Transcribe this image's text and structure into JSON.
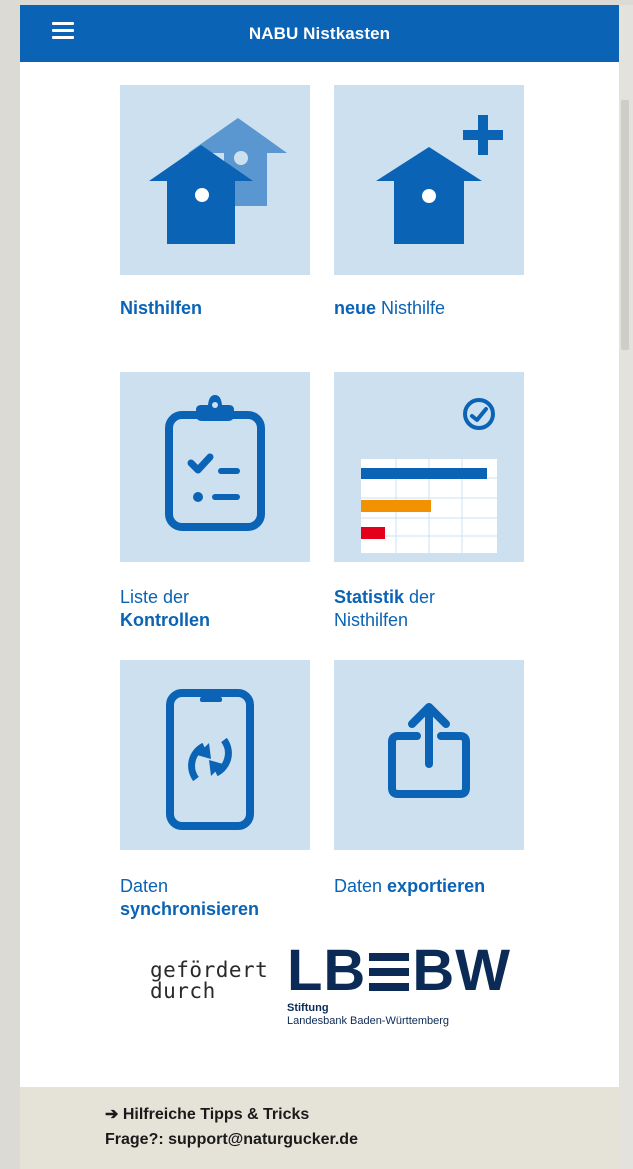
{
  "app": {
    "title": "NABU Nistkasten"
  },
  "tiles": {
    "nisthilfen": {
      "label_bold": "Nisthilfen"
    },
    "neue": {
      "label_bold": "neue",
      "label_rest": " Nisthilfe"
    },
    "liste": {
      "line1": "Liste der",
      "line2_bold": "Kontrollen"
    },
    "statistik": {
      "label_bold": "Statistik",
      "label_rest": " der",
      "line2": "Nisthilfen"
    },
    "sync": {
      "line1": "Daten",
      "line2_bold": "synchronisieren"
    },
    "export": {
      "label_rest": "Daten ",
      "label_bold": "exportieren"
    }
  },
  "sponsor": {
    "line1": "gefördert",
    "line2": "durch",
    "logo_left": "LB",
    "logo_right": "BW",
    "stiftung": "Stiftung",
    "bank": "Landesbank Baden-Württemberg"
  },
  "footer": {
    "tips": "➔ Hilfreiche Tipps & Tricks",
    "contact": "Frage?: support@naturgucker.de"
  },
  "colors": {
    "primary": "#0a63b5",
    "tile_bg": "#cde0f0",
    "orange": "#f39200",
    "red": "#e2001a"
  },
  "icons": [
    "menu-icon",
    "houses-icon",
    "house-plus-icon",
    "clipboard-checklist-icon",
    "statistics-chart-icon",
    "phone-sync-icon",
    "export-icon"
  ]
}
